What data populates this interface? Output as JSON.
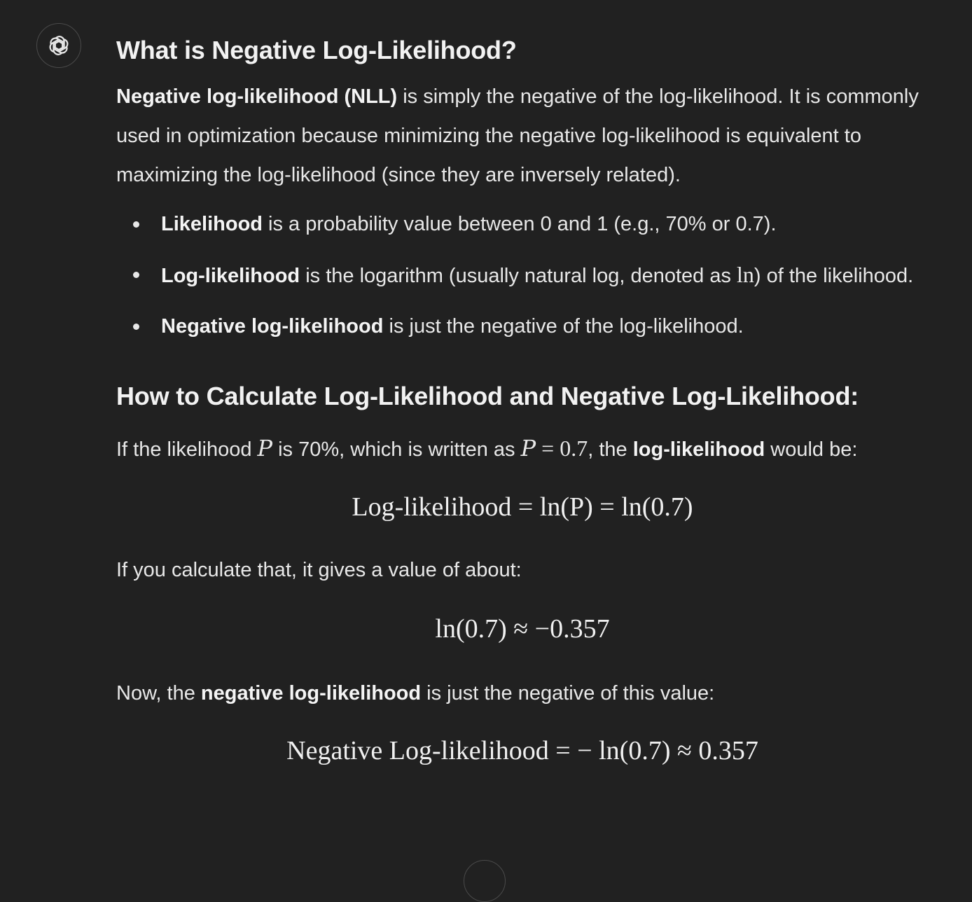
{
  "assistant": {
    "avatar_icon": "openai-logo-icon"
  },
  "section1": {
    "heading": "What is Negative Log-Likelihood?",
    "intro_bold": "Negative log-likelihood (NLL)",
    "intro_rest": " is simply the negative of the log-likelihood. It is commonly used in optimization because minimizing the negative log-likelihood is equivalent to maximizing the log-likelihood (since they are inversely related).",
    "bullets": [
      {
        "bold": "Likelihood",
        "text": " is a probability value between 0 and 1 (e.g., 70% or 0.7)."
      },
      {
        "bold": "Log-likelihood",
        "text_before": " is the logarithm (usually natural log, denoted as ",
        "math": "ln",
        "text_after": ") of the likelihood."
      },
      {
        "bold": "Negative log-likelihood",
        "text": " is just the negative of the log-likelihood."
      }
    ]
  },
  "section2": {
    "heading": "How to Calculate Log-Likelihood and Negative Log-Likelihood:",
    "p1_a": "If the likelihood ",
    "p1_math_P": "P",
    "p1_b": " is 70%, which is written as ",
    "p1_math_eq": "P = 0.7",
    "p1_c": ", the ",
    "p1_bold": "log-likelihood",
    "p1_d": " would be:",
    "eq1": "Log-likelihood = ln(P) = ln(0.7)",
    "p2": "If you calculate that, it gives a value of about:",
    "eq2": "ln(0.7) ≈ −0.357",
    "p3_a": "Now, the ",
    "p3_bold": "negative log-likelihood",
    "p3_b": " is just the negative of this value:",
    "eq3": "Negative Log-likelihood = − ln(0.7) ≈ 0.357"
  },
  "scroll_button": {
    "icon": "arrow-down-icon"
  }
}
